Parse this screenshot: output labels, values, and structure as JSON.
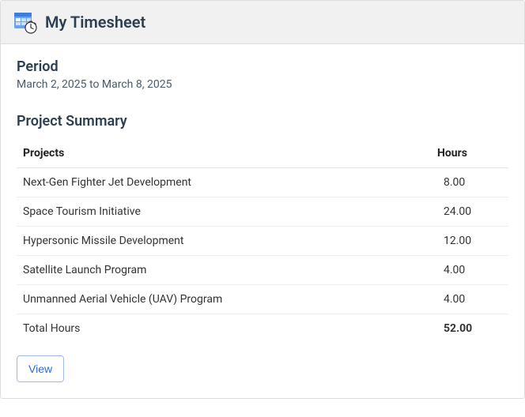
{
  "header": {
    "title": "My Timesheet"
  },
  "period": {
    "heading": "Period",
    "range": "March 2, 2025 to March 8, 2025"
  },
  "summary": {
    "heading": "Project Summary",
    "columns": {
      "project": "Projects",
      "hours": "Hours"
    },
    "rows": [
      {
        "project": "Next-Gen Fighter Jet Development",
        "hours": "8.00"
      },
      {
        "project": "Space Tourism Initiative",
        "hours": "24.00"
      },
      {
        "project": "Hypersonic Missile Development",
        "hours": "12.00"
      },
      {
        "project": "Satellite Launch Program",
        "hours": "4.00"
      },
      {
        "project": "Unmanned Aerial Vehicle (UAV) Program",
        "hours": "4.00"
      }
    ],
    "total": {
      "label": "Total Hours",
      "hours": "52.00"
    }
  },
  "actions": {
    "view_label": "View"
  }
}
